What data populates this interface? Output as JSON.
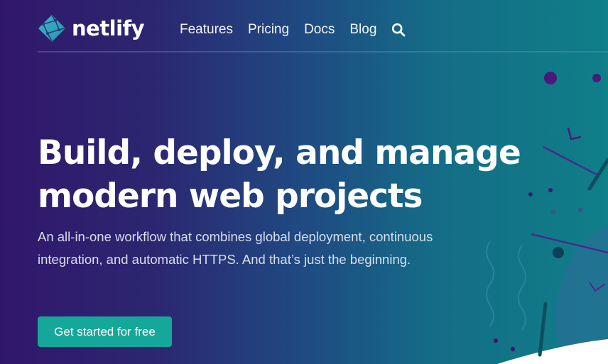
{
  "brand": {
    "name": "netlify",
    "logo_icon": "netlify-logo-icon"
  },
  "nav": {
    "items": [
      {
        "label": "Features"
      },
      {
        "label": "Pricing"
      },
      {
        "label": "Docs"
      },
      {
        "label": "Blog"
      }
    ],
    "search_icon": "search-icon"
  },
  "hero": {
    "title_line1": "Build, deploy, and manage",
    "title_line2": "modern web projects",
    "subtitle": "An all-in-one workflow that combines global deployment, continuous integration, and automatic HTTPS. And that’s just the beginning.",
    "cta_label": "Get started for free"
  },
  "colors": {
    "gradient_left": "#31176b",
    "gradient_right": "#0f7f88",
    "cta": "#15a89a",
    "accent_purple": "#4a1a7a",
    "accent_dark_teal": "#0d4f60"
  }
}
